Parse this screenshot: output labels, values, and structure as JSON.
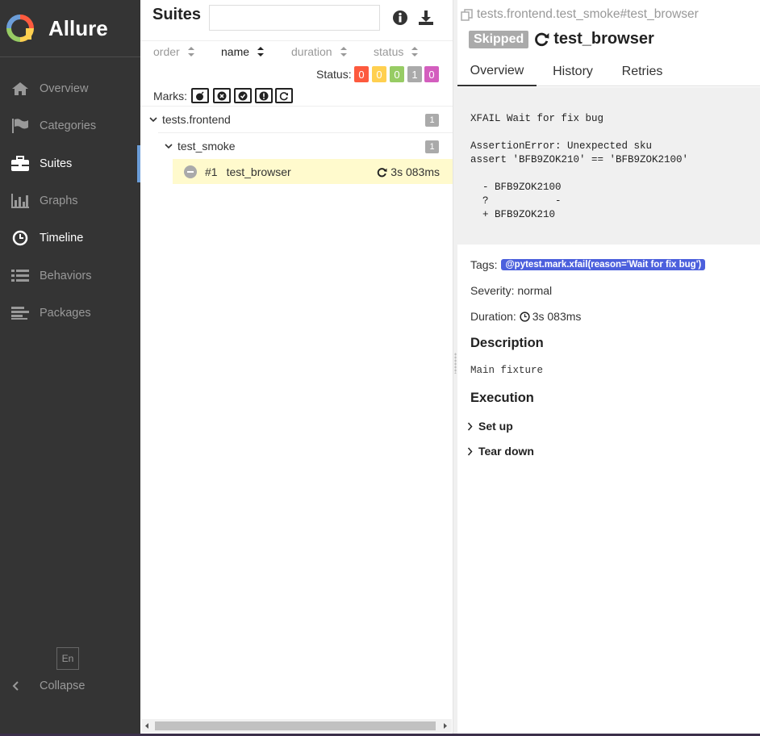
{
  "app": {
    "name": "Allure"
  },
  "sidebar": {
    "items": [
      {
        "label": "Overview",
        "icon": "home-icon"
      },
      {
        "label": "Categories",
        "icon": "flag-icon"
      },
      {
        "label": "Suites",
        "icon": "briefcase-icon",
        "active": true
      },
      {
        "label": "Graphs",
        "icon": "bar-chart-icon"
      },
      {
        "label": "Timeline",
        "icon": "clock-icon"
      },
      {
        "label": "Behaviors",
        "icon": "list-icon"
      },
      {
        "label": "Packages",
        "icon": "align-left-icon"
      }
    ],
    "language": "En",
    "collapse_label": "Collapse"
  },
  "suites_pane": {
    "title": "Suites",
    "search_placeholder": "",
    "sorters": [
      {
        "label": "order"
      },
      {
        "label": "name",
        "active": true
      },
      {
        "label": "duration"
      },
      {
        "label": "status"
      }
    ],
    "status_label": "Status:",
    "status_counts": [
      {
        "status": "failed",
        "value": "0",
        "color": "#fd5a3e"
      },
      {
        "status": "broken",
        "value": "0",
        "color": "#ffd050"
      },
      {
        "status": "passed",
        "value": "0",
        "color": "#97cc64"
      },
      {
        "status": "skipped",
        "value": "1",
        "color": "#aaaaaa"
      },
      {
        "status": "unknown",
        "value": "0",
        "color": "#d35ebe"
      }
    ],
    "marks_label": "Marks:",
    "marks": [
      "bomb-icon",
      "close-circle-icon",
      "check-circle-icon",
      "exclamation-circle-icon",
      "retry-icon"
    ],
    "tree": {
      "group": {
        "name": "tests.frontend",
        "count": "1"
      },
      "subgroup": {
        "name": "test_smoke",
        "count": "1"
      },
      "leaf": {
        "order": "#1",
        "name": "test_browser",
        "duration": "3s 083ms"
      }
    }
  },
  "test_result": {
    "breadcrumb": "tests.frontend.test_smoke#test_browser",
    "status": "Skipped",
    "name": "test_browser",
    "tabs": [
      "Overview",
      "History",
      "Retries"
    ],
    "error": "XFAIL Wait for fix bug\n\nAssertionError: Unexpected sku\nassert 'BFB9ZOK210' == 'BFB9ZOK2100'\n\n  - BFB9ZOK2100\n  ?           -\n  + BFB9ZOK210",
    "tags_label": "Tags:",
    "tag": "@pytest.mark.xfail(reason='Wait for fix bug')",
    "severity_label": "Severity:",
    "severity": "normal",
    "duration_label": "Duration:",
    "duration": "3s 083ms",
    "description_title": "Description",
    "description": "Main fixture",
    "execution_title": "Execution",
    "steps": [
      "Set up",
      "Tear down"
    ]
  }
}
